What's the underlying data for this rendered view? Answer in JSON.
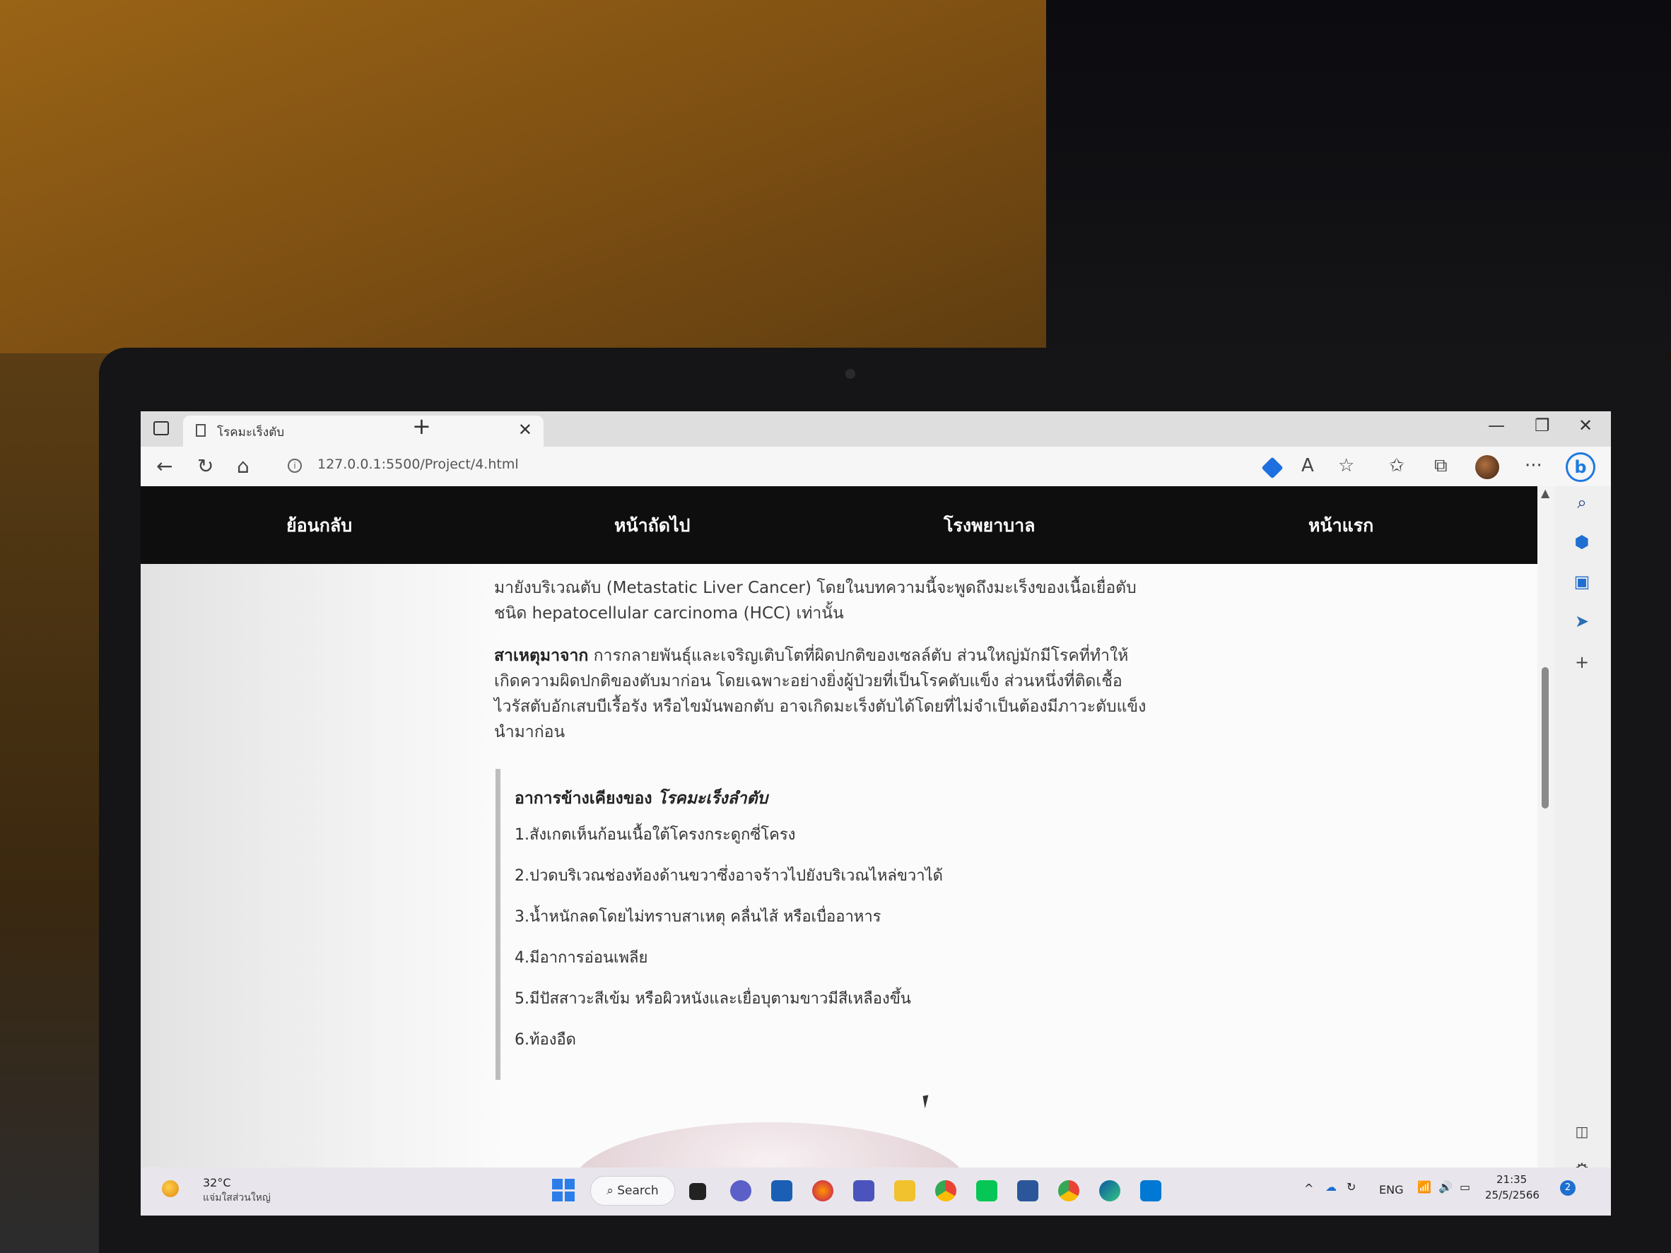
{
  "browser": {
    "tab_title": "โรคมะเร็งตับ",
    "tab_close": "✕",
    "new_tab": "+",
    "url": "127.0.0.1:5500/Project/4.html",
    "minimize": "—",
    "maximize": "❐",
    "close": "✕",
    "back": "←",
    "reload": "↻",
    "home": "⌂",
    "more": "···",
    "read_aloud": "A",
    "bing": "b"
  },
  "nav": {
    "back": "ย้อนกลับ",
    "next": "หน้าถัดไป",
    "hospital": "โรงพยาบาล",
    "home": "หน้าแรก"
  },
  "article": {
    "intro": "มายังบริเวณตับ (Metastatic Liver Cancer) โดยในบทความนี้จะพูดถึงมะเร็งของเนื้อเยื่อตับชนิด hepatocellular carcinoma (HCC) เท่านั้น",
    "cause_label": "สาเหตุมาจาก",
    "cause_text": " การกลายพันธุ์และเจริญเติบโตที่ผิดปกติของเซลล์ตับ ส่วนใหญ่มักมีโรคที่ทำให้เกิดความผิดปกติของตับมาก่อน โดยเฉพาะอย่างยิ่งผู้ป่วยที่เป็นโรคตับแข็ง ส่วนหนึ่งที่ติดเชื้อไวรัสตับอักเสบบีเรื้อรัง หรือไขมันพอกตับ อาจเกิดมะเร็งตับได้โดยที่ไม่จำเป็นต้องมีภาวะตับแข็งนำมาก่อน",
    "symptoms_heading": "อาการข้างเคียงของ ",
    "symptoms_heading_em": "โรคมะเร็งลำตับ",
    "symptoms": [
      "1.สังเกตเห็นก้อนเนื้อใต้โครงกระดูกซี่โครง",
      "2.ปวดบริเวณช่องท้องด้านขวาซึ่งอาจร้าวไปยังบริเวณไหล่ขวาได้",
      "3.น้ำหนักลดโดยไม่ทราบสาเหตุ คลื่นไส้ หรือเบื่ออาหาร",
      "4.มีอาการอ่อนเพลีย",
      "5.มีปัสสาวะสีเข้ม หรือผิวหนังและเยื่อบุตามขาวมีสีเหลืองขึ้น",
      "6.ท้องอืด"
    ]
  },
  "taskbar": {
    "weather_temp": "32°C",
    "weather_desc": "แจ่มใสส่วนใหญ่",
    "search": "Search",
    "lang": "ENG",
    "time": "21:35",
    "date": "25/5/2566",
    "notification_count": "2"
  },
  "colors": {
    "navbar": "#0e0e0e",
    "accent": "#1f7ae0",
    "quote_border": "#bdbdbd"
  }
}
